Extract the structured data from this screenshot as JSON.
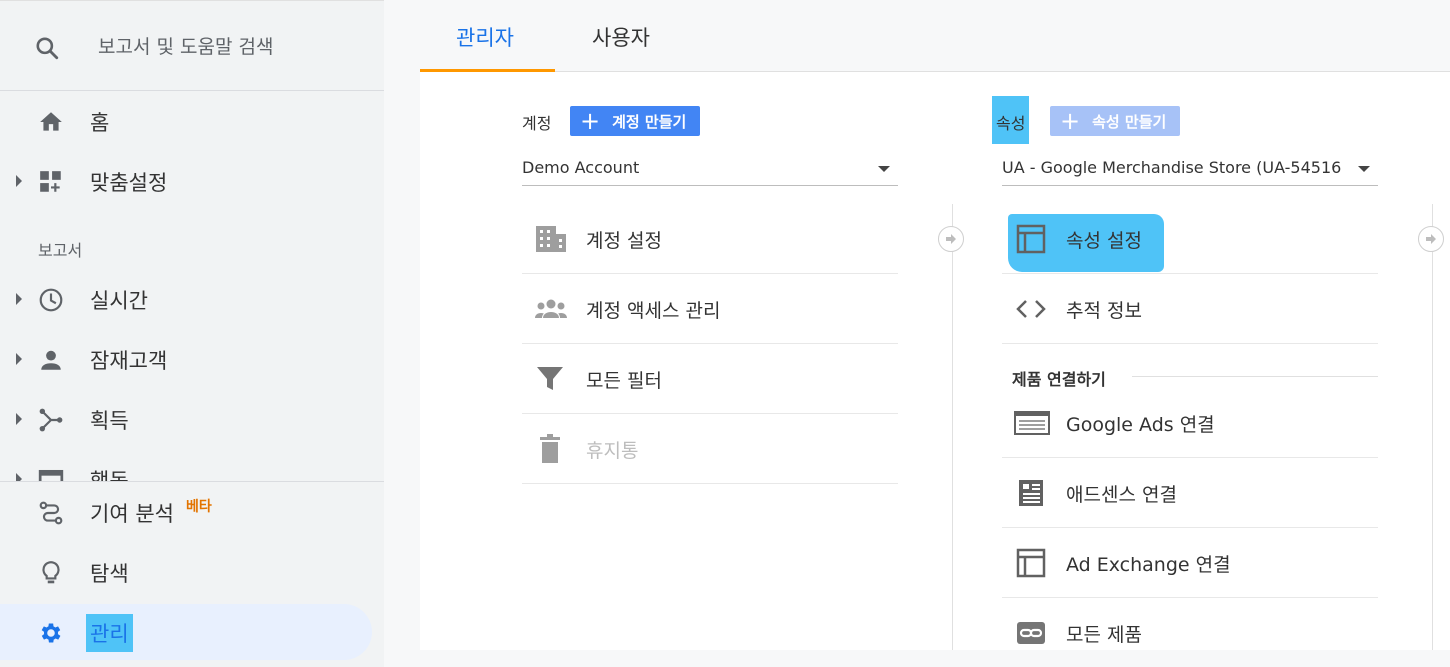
{
  "search": {
    "placeholder": "보고서 및 도움말 검색"
  },
  "sidebar": {
    "home": "홈",
    "custom": "맞춤설정",
    "reports_label": "보고서",
    "realtime": "실시간",
    "audience": "잠재고객",
    "acquisition": "획득",
    "behavior": "행동",
    "attribution": "기여 분석",
    "attribution_badge": "베타",
    "discover": "탐색",
    "admin": "관리"
  },
  "tabs": {
    "admin": "관리자",
    "user": "사용자"
  },
  "account": {
    "label": "계정",
    "create": "계정 만들기",
    "selected": "Demo Account",
    "items": [
      "계정 설정",
      "계정 액세스 관리",
      "모든 필터",
      "휴지통"
    ]
  },
  "property": {
    "label": "속성",
    "create": "속성 만들기",
    "selected": "UA - Google Merchandise Store (UA-54516...",
    "items": [
      "속성 설정",
      "추적 정보"
    ],
    "product_links_label": "제품 연결하기",
    "links": [
      "Google Ads 연결",
      "애드센스 연결",
      "Ad Exchange 연결",
      "모든 제품"
    ]
  },
  "colors": {
    "accent": "#1a73e8",
    "button": "#4285f4",
    "tab_underline": "#ff9800",
    "highlight": "#4fc3f7",
    "badge": "#e37400"
  }
}
